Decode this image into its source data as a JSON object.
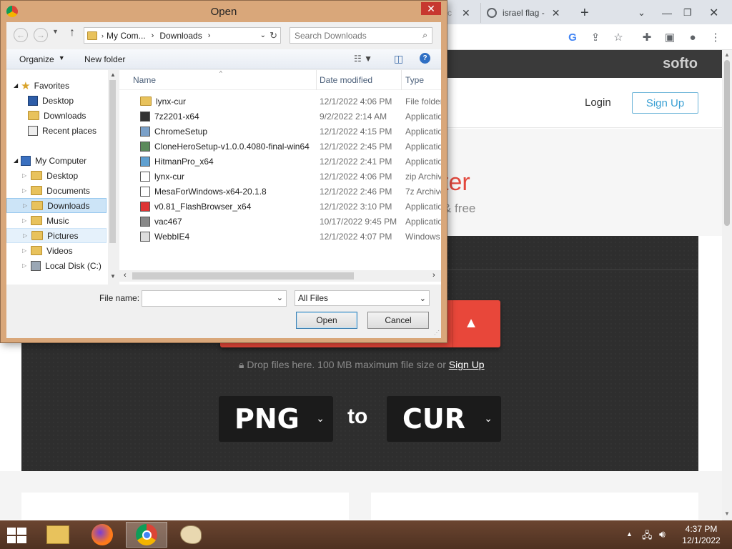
{
  "browser": {
    "tabs": [
      {
        "label": "israel flag - "
      }
    ],
    "new_tab": "+",
    "site_logo": "softo",
    "login": "Login",
    "signup": "Sign Up",
    "hero_title_partial": "ter",
    "hero_sub_partial": "& free",
    "drop_text": "Drop files here. 100 MB maximum file size or",
    "drop_link": "Sign Up",
    "from_format": "PNG",
    "to_word": "to",
    "to_format": "CUR"
  },
  "dialog": {
    "title": "Open",
    "breadcrumb": [
      "My Com...",
      "Downloads"
    ],
    "search_placeholder": "Search Downloads",
    "organize": "Organize",
    "new_folder": "New folder",
    "tree": {
      "favorites": {
        "label": "Favorites",
        "items": [
          "Desktop",
          "Downloads",
          "Recent places"
        ]
      },
      "computer": {
        "label": "My Computer",
        "items": [
          "Desktop",
          "Documents",
          "Downloads",
          "Music",
          "Pictures",
          "Videos",
          "Local Disk (C:)"
        ]
      }
    },
    "columns": [
      "Name",
      "Date modified",
      "Type"
    ],
    "files": [
      {
        "name": "lynx-cur",
        "date": "12/1/2022 4:06 PM",
        "type": "File folder",
        "icon": "folder-icon"
      },
      {
        "name": "7z2201-x64",
        "date": "9/2/2022 2:14 AM",
        "type": "Applicatio",
        "icon": "7z-icon"
      },
      {
        "name": "ChromeSetup",
        "date": "12/1/2022 4:15 PM",
        "type": "Applicatio",
        "icon": "chrome-setup-icon"
      },
      {
        "name": "CloneHeroSetup-v1.0.0.4080-final-win64",
        "date": "12/1/2022 2:45 PM",
        "type": "Applicatio",
        "icon": "clonehero-icon"
      },
      {
        "name": "HitmanPro_x64",
        "date": "12/1/2022 2:41 PM",
        "type": "Applicatio",
        "icon": "hitmanpro-icon"
      },
      {
        "name": "lynx-cur",
        "date": "12/1/2022 4:06 PM",
        "type": "zip Archiv",
        "icon": "zip-icon"
      },
      {
        "name": "MesaForWindows-x64-20.1.8",
        "date": "12/1/2022 2:46 PM",
        "type": "7z Archive",
        "icon": "7z-archive-icon"
      },
      {
        "name": "v0.81_FlashBrowser_x64",
        "date": "12/1/2022 3:10 PM",
        "type": "Applicatio",
        "icon": "flashbrowser-icon"
      },
      {
        "name": "vac467",
        "date": "10/17/2022 9:45 PM",
        "type": "Applicatio",
        "icon": "app-icon"
      },
      {
        "name": "WebbIE4",
        "date": "12/1/2022 4:07 PM",
        "type": "Windows",
        "icon": "installer-icon"
      }
    ],
    "file_name_label": "File name:",
    "file_name_value": "",
    "filter": "All Files",
    "open": "Open",
    "cancel": "Cancel"
  },
  "taskbar": {
    "time": "4:37 PM",
    "date": "12/1/2022"
  }
}
